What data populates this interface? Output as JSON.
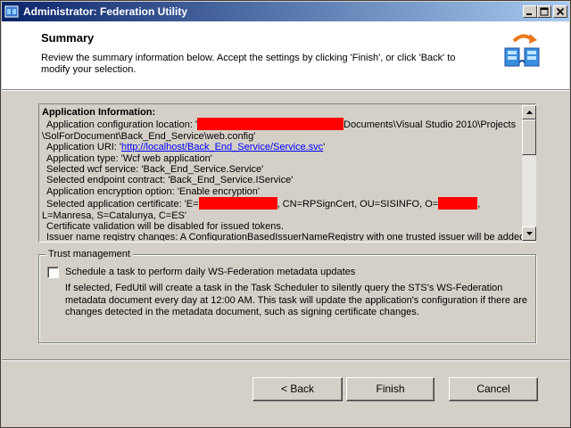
{
  "window": {
    "title": "Administrator: Federation Utility",
    "title_color_start": "#0a246a",
    "title_color_end": "#a6caf0"
  },
  "header": {
    "title": "Summary",
    "description": "Review the summary information below. Accept the settings by clicking 'Finish', or click 'Back' to modify your selection.",
    "icon": "federation-sync-icon"
  },
  "summary": {
    "heading": "Application Information:",
    "config_location_prefix": "Application configuration location: '",
    "config_location_suffix": "Documents\\Visual Studio 2010\\Projects",
    "config_location_cont": "\\SolForDocument\\Back_End_Service\\web.config'",
    "app_uri_prefix": "Application URI: '",
    "app_uri_link": "http://localhost/Back_End_Service/Service.svc",
    "app_uri_suffix": "'",
    "app_type": "Application type: 'Wcf web application'",
    "wcf_service": "Selected wcf service: 'Back_End_Service.Service'",
    "endpoint_contract": "Selected endpoint contract: 'Back_End_Service.IService'",
    "encryption": "Application encryption option: 'Enable encryption'",
    "cert_prefix": "Selected application certificate: 'E=",
    "cert_mid": ", CN=RPSignCert, OU=SISINFO, O=",
    "cert_suffix": ",",
    "cert_cont": "L=Manresa, S=Catalunya, C=ES'",
    "cert_validation": "Certificate validation will be disabled for issued tokens.",
    "issuer_registry": "Issuer name registry changes: A ConfigurationBasedIssuerNameRegistry with one trusted issuer will be added to"
  },
  "trust": {
    "group_label": "Trust management",
    "checkbox_label": "Schedule a task to perform daily WS-Federation metadata updates",
    "checked": false,
    "description": "If selected, FedUtil will create a task in the Task Scheduler to silently query the STS's WS-Federation metadata document every day at 12:00 AM.  This task will update the application's configuration if there are changes detected in the metadata document, such as signing certificate changes."
  },
  "buttons": {
    "back": "< Back",
    "finish": "Finish",
    "cancel": "Cancel"
  },
  "colors": {
    "redaction": "#ff0000",
    "link": "#0000ff"
  }
}
